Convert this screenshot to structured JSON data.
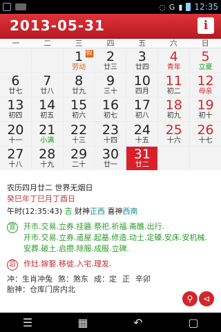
{
  "statusbar": {
    "time": "12:35",
    "network": "G"
  },
  "header": {
    "date": "2013-05-31",
    "info_icon": "i"
  },
  "weekdays": [
    "一",
    "二",
    "三",
    "四",
    "五",
    "六",
    "日"
  ],
  "calendar": {
    "cells": [
      {
        "day": "",
        "lunar": ""
      },
      {
        "day": "",
        "lunar": ""
      },
      {
        "day": "1",
        "lunar": "劳动",
        "lunar_color": "orange",
        "badge": "假"
      },
      {
        "day": "2",
        "lunar": "廿三"
      },
      {
        "day": "3",
        "lunar": "廿四"
      },
      {
        "day": "4",
        "lunar": "青年",
        "lunar_color": "red",
        "day_color": "red"
      },
      {
        "day": "5",
        "lunar": "立夏",
        "lunar_color": "green",
        "day_color": "red"
      },
      {
        "day": "6",
        "lunar": "廿七"
      },
      {
        "day": "7",
        "lunar": "廿八"
      },
      {
        "day": "8",
        "lunar": "廿九"
      },
      {
        "day": "9",
        "lunar": "三十"
      },
      {
        "day": "10",
        "lunar": "四月"
      },
      {
        "day": "11",
        "lunar": "初二",
        "day_color": "red"
      },
      {
        "day": "12",
        "lunar": "母亲",
        "lunar_color": "red",
        "day_color": "red"
      },
      {
        "day": "13",
        "lunar": "初四"
      },
      {
        "day": "14",
        "lunar": "初五"
      },
      {
        "day": "15",
        "lunar": "初六"
      },
      {
        "day": "16",
        "lunar": "初七"
      },
      {
        "day": "17",
        "lunar": "初八"
      },
      {
        "day": "18",
        "lunar": "初九",
        "day_color": "red"
      },
      {
        "day": "19",
        "lunar": "初十",
        "day_color": "red"
      },
      {
        "day": "20",
        "lunar": "十一"
      },
      {
        "day": "21",
        "lunar": "小满",
        "lunar_color": "green"
      },
      {
        "day": "22",
        "lunar": "十三"
      },
      {
        "day": "23",
        "lunar": "十四"
      },
      {
        "day": "24",
        "lunar": "十五"
      },
      {
        "day": "25",
        "lunar": "十六",
        "day_color": "red"
      },
      {
        "day": "26",
        "lunar": "十七",
        "day_color": "red"
      },
      {
        "day": "27",
        "lunar": "十八"
      },
      {
        "day": "28",
        "lunar": "十九"
      },
      {
        "day": "29",
        "lunar": "二十"
      },
      {
        "day": "30",
        "lunar": "廿一"
      },
      {
        "day": "31",
        "lunar": "廿二",
        "selected": true
      },
      {
        "day": "",
        "lunar": ""
      },
      {
        "day": "",
        "lunar": ""
      }
    ]
  },
  "info": {
    "lunar_line": "农历四月廿二  世界无烟日",
    "ganzhi_line": "癸巳年丁巳月丁酉日",
    "hour_prefix": "午时(12:35:43)",
    "hour_luck": "吉",
    "god_prefix": "财神",
    "god_wealth_dir": "正西",
    "god_joy_label": "喜神",
    "god_joy_dir": "西南",
    "yi_label": "宜",
    "yi_text_1": "开市.交易.立券.挂匾.祭祀.祈福.斋醮.出行.",
    "yi_text_2": "开市.交易.立券.遣屋.起基.修造.动土.定磉.安床.安机械.安葬.破土.启攒.除服.成服.立碑.",
    "ji_label": "忌",
    "ji_text": "作灶.嫁娶.移徙.入宅.理发.",
    "chong": "冲：生肖冲兔",
    "sha": "煞：煞东",
    "cheng": "成：定",
    "chong_extra": "正",
    "chong_extra2": "辛卯",
    "taishen": "胎神：仓库门房内北"
  }
}
